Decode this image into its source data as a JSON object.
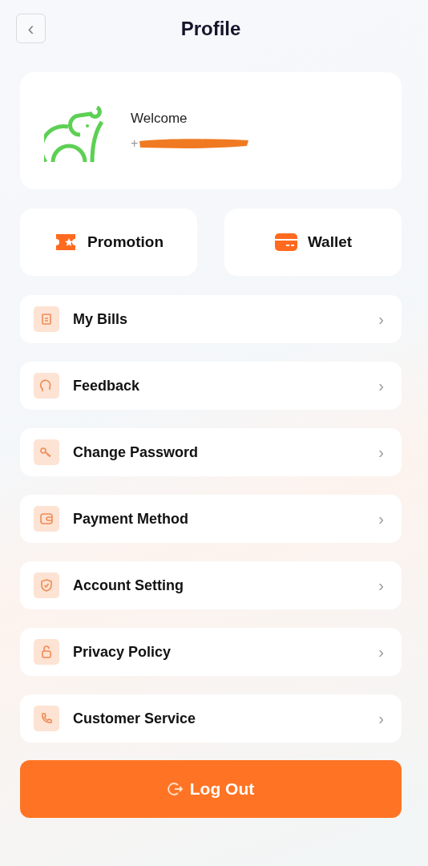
{
  "header": {
    "back": "‹",
    "title": "Profile"
  },
  "profile": {
    "greeting": "Welcome",
    "phone": "+"
  },
  "tiles": [
    {
      "label": "Promotion"
    },
    {
      "label": "Wallet"
    }
  ],
  "menu": [
    {
      "label": "My Bills",
      "chevron": "›"
    },
    {
      "label": "Feedback",
      "chevron": "›"
    },
    {
      "label": "Change Password",
      "chevron": "›"
    },
    {
      "label": "Payment Method",
      "chevron": "›"
    },
    {
      "label": "Account Setting",
      "chevron": "›"
    },
    {
      "label": "Privacy Policy",
      "chevron": "›"
    },
    {
      "label": "Customer Service",
      "chevron": "›"
    }
  ],
  "logout": {
    "label": "Log Out"
  }
}
